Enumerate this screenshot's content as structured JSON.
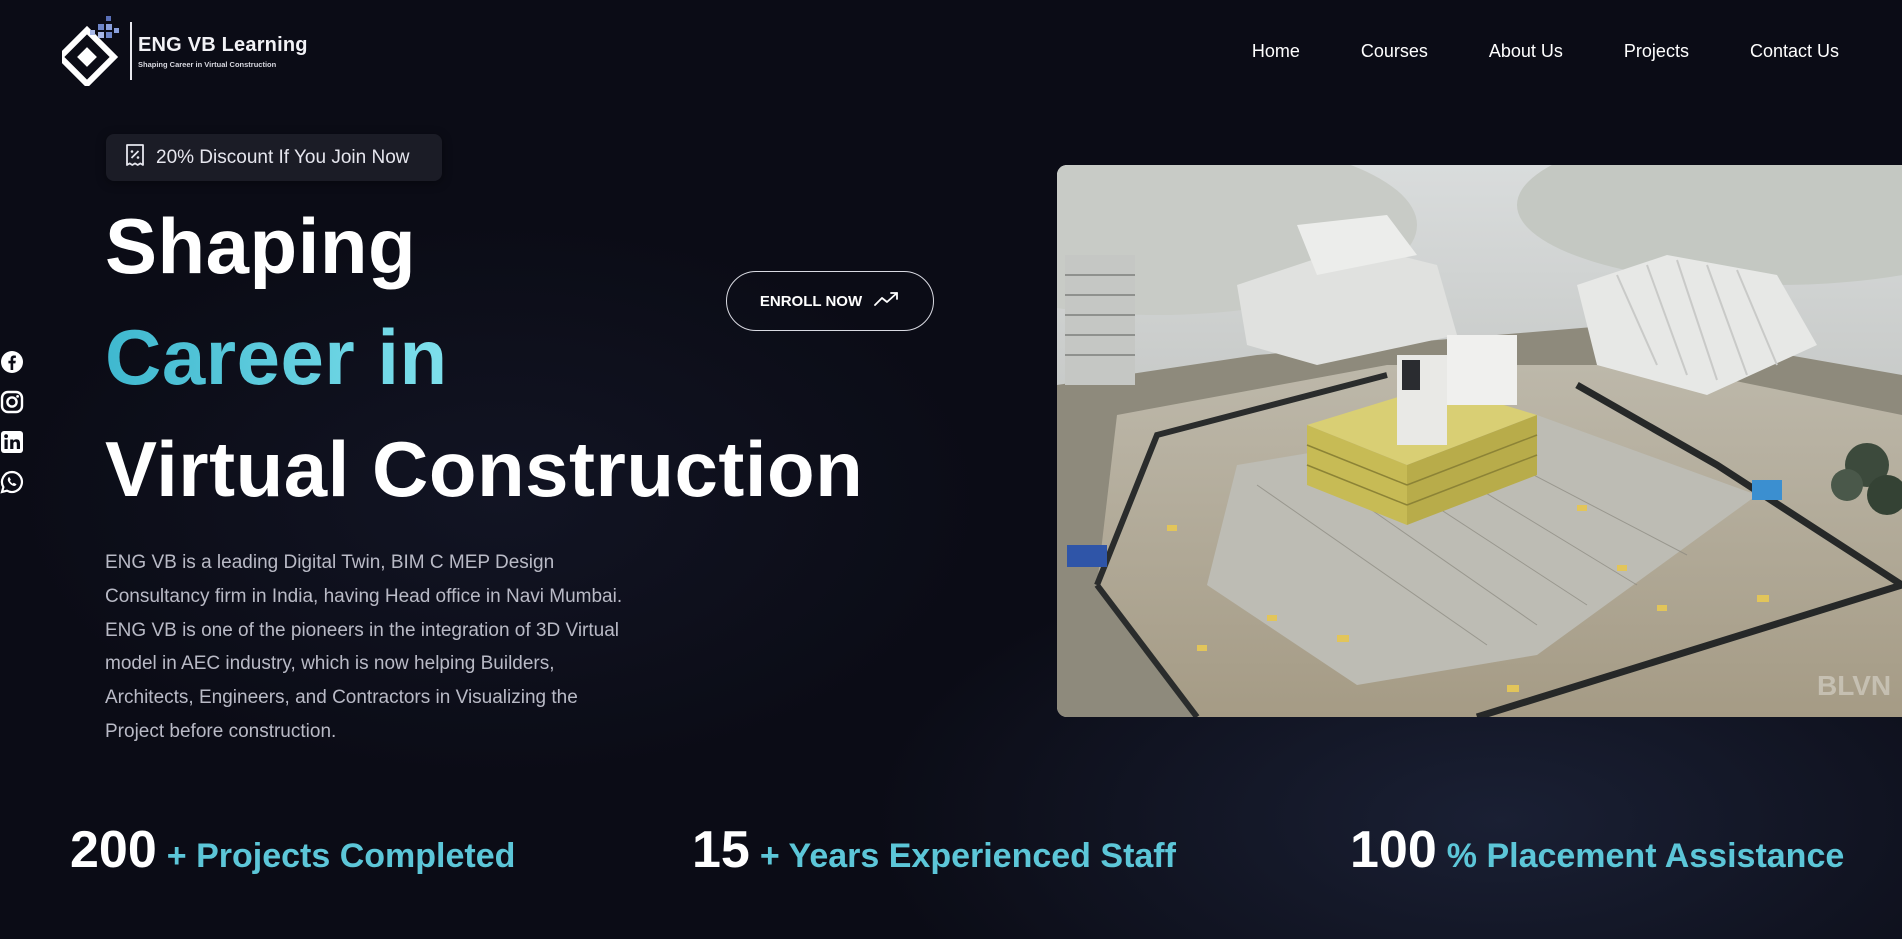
{
  "brand": {
    "name": "ENG VB Learning",
    "tagline": "Shaping Career in Virtual Construction"
  },
  "nav": {
    "items": [
      {
        "label": "Home"
      },
      {
        "label": "Courses"
      },
      {
        "label": "About Us"
      },
      {
        "label": "Projects"
      },
      {
        "label": "Contact Us"
      }
    ]
  },
  "social": [
    "facebook-icon",
    "instagram-icon",
    "linkedin-icon",
    "whatsapp-icon"
  ],
  "hero": {
    "badge": "20% Discount If You Join Now",
    "line1": "Shaping",
    "line2": "Career in",
    "line3": "Virtual Construction",
    "description": "ENG VB is a leading Digital Twin, BIM C MEP Design Consultancy firm in India, having Head office in Navi Mumbai. ENG VB is one of the pioneers in the integration of 3D Virtual model in AEC industry, which is now helping Builders, Architects, Engineers, and Contractors in Visualizing the Project before construction.",
    "cta": "ENROLL NOW",
    "image_watermark": "BLVN"
  },
  "stats": [
    {
      "number": "200",
      "label": "+ Projects Completed"
    },
    {
      "number": "15",
      "label": "+ Years Experienced Staff"
    },
    {
      "number": "100",
      "label": "% Placement Assistance"
    }
  ],
  "colors": {
    "background": "#0b0c16",
    "accent": "#5cc6d8",
    "accent_gradient_start": "#3fb8cf",
    "accent_gradient_end": "#7ee0ec"
  }
}
